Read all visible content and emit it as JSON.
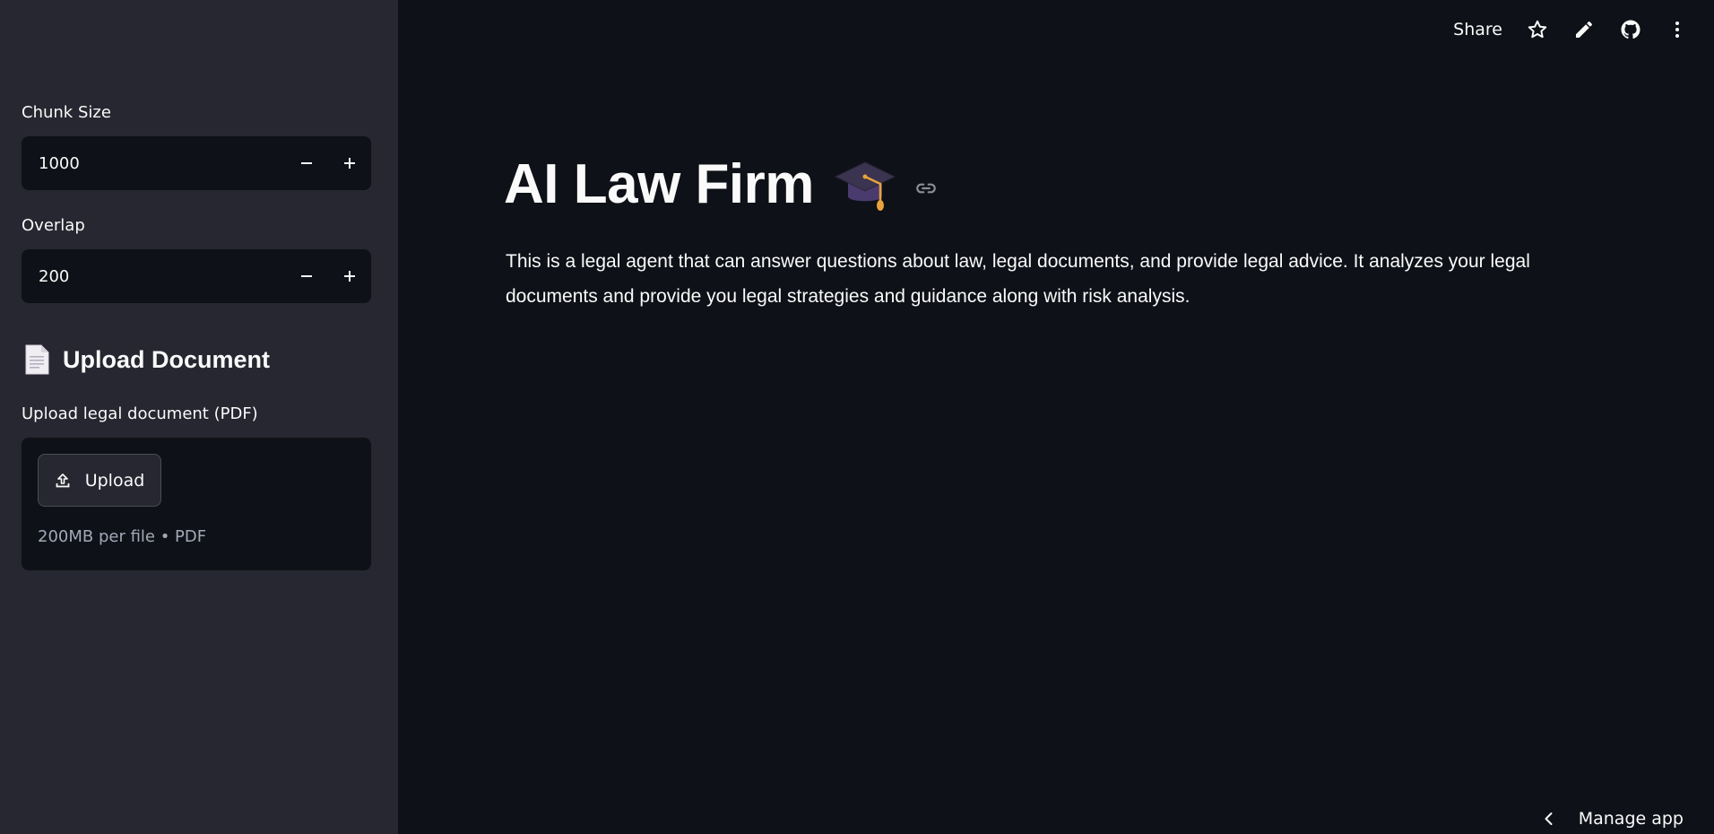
{
  "sidebar": {
    "chunk_size": {
      "label": "Chunk Size",
      "value": "1000"
    },
    "overlap": {
      "label": "Overlap",
      "value": "200"
    },
    "upload_section": {
      "heading": "Upload Document",
      "icon": "page-facing-up-icon",
      "field_label": "Upload legal document (PDF)",
      "button_label": "Upload",
      "hint": "200MB per file • PDF"
    }
  },
  "toolbar": {
    "share_label": "Share",
    "icons": [
      "star-icon",
      "pencil-icon",
      "github-icon",
      "more-vert-icon"
    ]
  },
  "main": {
    "title": "AI Law Firm",
    "title_icon": "graduation-cap-icon",
    "description": "This is a legal agent that can answer questions about law, legal documents, and provide legal advice. It analyzes your legal documents and provide you legal strategies and guidance along with risk analysis."
  },
  "footer": {
    "manage_app_label": "Manage app"
  },
  "colors": {
    "background": "#0e1117",
    "sidebar": "#262730",
    "text": "#fafafa",
    "muted_text": "#a3a8b8"
  }
}
